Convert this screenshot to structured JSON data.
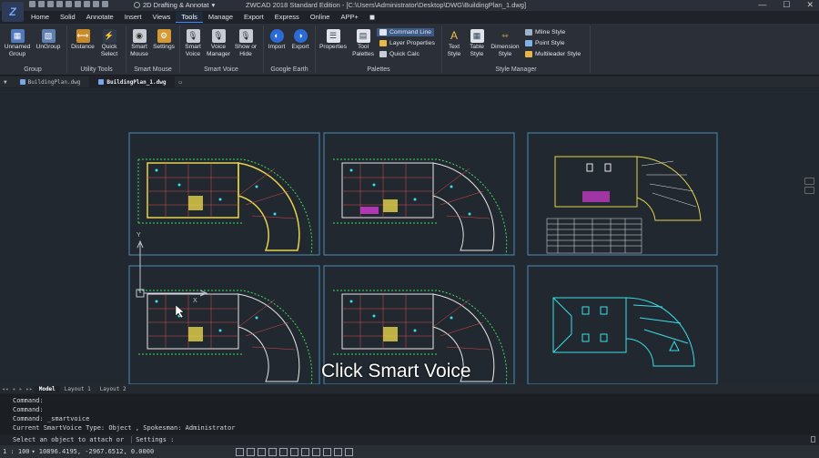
{
  "app": {
    "workspace": "2D Drafting & Annotat",
    "title": "ZWCAD 2018 Standard Edition - [C:\\Users\\Administrator\\Desktop\\DWG\\BuildingPlan_1.dwg]"
  },
  "menu": [
    "Home",
    "Solid",
    "Annotate",
    "Insert",
    "Views",
    "Tools",
    "Manage",
    "Export",
    "Express",
    "Online",
    "APP+"
  ],
  "active_menu": "Tools",
  "ribbon": {
    "unnamed_group": "Unnamed Group",
    "ungroup": "UnGroup",
    "distance": "Distance",
    "quick_select": "Quick Select",
    "smart_mouse": "Smart Mouse",
    "settings": "Settings",
    "smart_voice": "Smart Voice",
    "voice_manager": "Voice Manager",
    "show_or_hide": "Show or Hide",
    "import": "Import",
    "export": "Export",
    "properties": "Properties",
    "tool_palettes": "Tool Palettes",
    "command_line": "Command Line",
    "layer_properties": "Layer Properties",
    "quick_calc": "Quick Calc",
    "text_style": "Text Style",
    "table_style": "Table Style",
    "dimension_style": "Dimension Style",
    "mline_style": "Mline Style",
    "point_style": "Point Style",
    "multileader_style": "Multileader Style",
    "groups": [
      "Group",
      "Utility Tools",
      "Smart Mouse",
      "Smart Voice",
      "Google Earth",
      "Palettes",
      "Style Manager"
    ]
  },
  "doc_tabs": [
    "BuildingPlan.dwg",
    "BuildingPlan_1.dwg"
  ],
  "layout_tabs": [
    "Model",
    "Layout 1",
    "Layout 2"
  ],
  "active_layout": "Model",
  "command_history": [
    "Command:",
    "Command:",
    "Command: _smartvoice",
    "Current SmartVoice Type: Object , Spokesman: Administrator"
  ],
  "command_prompt": "Select an object to attach or",
  "command_option": "Settings :",
  "status": {
    "scale": "1 : 100",
    "coords": "10896.4195, -2967.6512, 0.0000"
  },
  "caption": "Click Smart Voice",
  "ucs": {
    "y": "Y",
    "x": "X"
  },
  "colors": {
    "accent": "#3b8bff",
    "viewport_border": "#4d8cb8",
    "canvas": "#212830"
  }
}
